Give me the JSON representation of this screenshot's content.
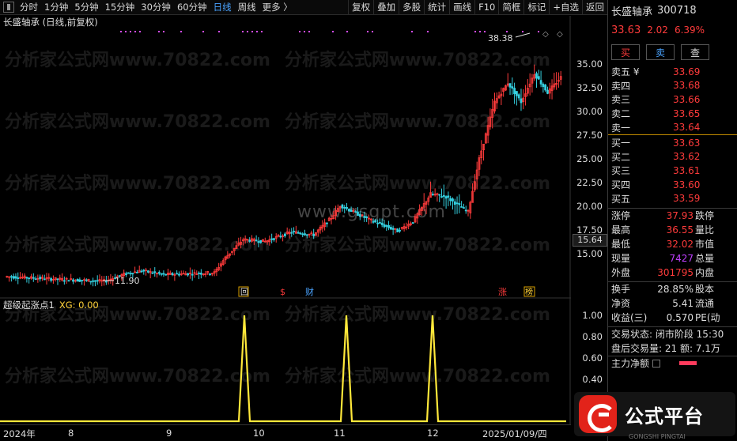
{
  "toolbar": {
    "left": [
      "分时",
      "1分钟",
      "5分钟",
      "15分钟",
      "30分钟",
      "60分钟",
      "日线",
      "周线",
      "更多 〉"
    ],
    "active": "日线",
    "right": [
      "复权",
      "叠加",
      "多股",
      "统计",
      "画线",
      "F10",
      "简框",
      "标记",
      "+自选",
      "返回"
    ]
  },
  "chart": {
    "title": "长盛轴承 (日线,前复权)",
    "high_label": "38.38",
    "low_label": "11.90",
    "current_tag": "15.64",
    "price_ticks": [
      "35.00",
      "32.50",
      "30.00",
      "27.50",
      "25.00",
      "22.50",
      "20.00",
      "17.50",
      "15.00"
    ],
    "markers": [
      "回",
      "$",
      "财",
      "涨",
      "榜"
    ],
    "watermark_center": "www.gsgpt.com",
    "watermark_text": "分析家公式网www.70822.com"
  },
  "indicator": {
    "name": "超级起涨点1",
    "xg_label": "XG: 0.00",
    "ticks": [
      "1.00",
      "0.80",
      "0.60",
      "0.40"
    ]
  },
  "date_axis": [
    "2024年",
    "8",
    "9",
    "10",
    "11",
    "12",
    "2025/01/09/四"
  ],
  "panel": {
    "name": "长盛轴承",
    "code": "300718",
    "price": "33.63",
    "change": "2.02",
    "pct": "6.39%",
    "buy_btn": "买",
    "sell_btn": "卖",
    "query_btn": "查",
    "asks": [
      {
        "label": "卖五 ¥",
        "price": "33.69"
      },
      {
        "label": "卖四",
        "price": "33.68"
      },
      {
        "label": "卖三",
        "price": "33.66"
      },
      {
        "label": "卖二",
        "price": "33.65"
      },
      {
        "label": "卖一",
        "price": "33.64"
      }
    ],
    "bids": [
      {
        "label": "买一",
        "price": "33.63"
      },
      {
        "label": "买二",
        "price": "33.62"
      },
      {
        "label": "买三",
        "price": "33.61"
      },
      {
        "label": "买四",
        "price": "33.60"
      },
      {
        "label": "买五",
        "price": "33.59"
      }
    ],
    "stats1": [
      {
        "label": "涨停",
        "value": "37.93",
        "right": "跌停"
      },
      {
        "label": "最高",
        "value": "36.55",
        "right": "量比"
      },
      {
        "label": "最低",
        "value": "32.02",
        "right": "市值"
      },
      {
        "label": "现量",
        "value": "7427",
        "right": "总量"
      },
      {
        "label": "外盘",
        "value": "301795",
        "right": "内盘"
      }
    ],
    "stats2": [
      {
        "label": "换手",
        "value": "28.85%",
        "right": "股本"
      },
      {
        "label": "净资",
        "value": "5.41",
        "right": "流通"
      },
      {
        "label": "收益(三)",
        "value": "0.570",
        "right": "PE(动"
      }
    ],
    "trade_status": "交易状态: 闭市阶段 15:30",
    "after_volume": "盘后交易量: 21  额: 7.1万",
    "main_flow": "主力净额"
  },
  "logo": {
    "text": "公式平台",
    "sub": "GONGSHI PINGTAI"
  }
}
